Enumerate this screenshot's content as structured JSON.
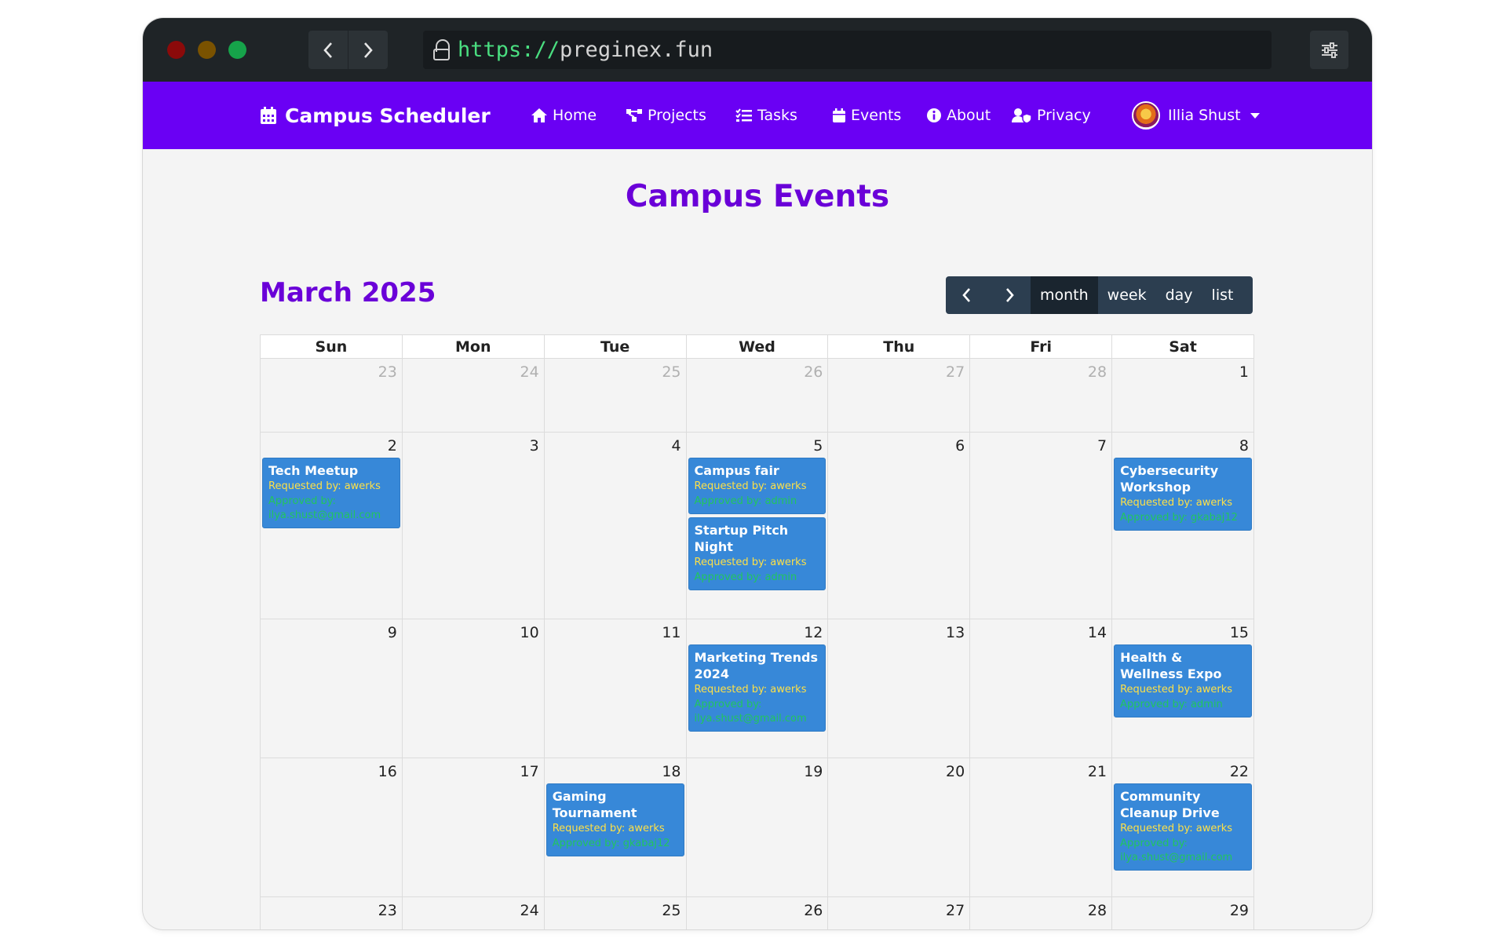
{
  "browser": {
    "url_scheme": "https://",
    "url_host": "preginex.fun"
  },
  "navbar": {
    "brand": "Campus Scheduler",
    "items": [
      {
        "label": "Home",
        "icon": "home-icon"
      },
      {
        "label": "Projects",
        "icon": "projects-icon"
      },
      {
        "label": "Tasks",
        "icon": "tasks-icon"
      },
      {
        "label": "Events",
        "icon": "calendar-icon"
      },
      {
        "label": "About",
        "icon": "info-icon"
      },
      {
        "label": "Privacy",
        "icon": "user-shield-icon"
      }
    ],
    "user": "Illia Shust"
  },
  "page": {
    "title": "Campus Events"
  },
  "calendar": {
    "month_title": "March 2025",
    "views": [
      "month",
      "week",
      "day",
      "list"
    ],
    "active_view": "month",
    "weekdays": [
      "Sun",
      "Mon",
      "Tue",
      "Wed",
      "Thu",
      "Fri",
      "Sat"
    ],
    "weeks": [
      [
        {
          "day": "23",
          "other": true
        },
        {
          "day": "24",
          "other": true
        },
        {
          "day": "25",
          "other": true
        },
        {
          "day": "26",
          "other": true
        },
        {
          "day": "27",
          "other": true
        },
        {
          "day": "28",
          "other": true
        },
        {
          "day": "1"
        }
      ],
      [
        {
          "day": "2",
          "events": [
            {
              "title": "Tech Meetup",
              "requested": "Requested by: awerks",
              "approved": "Approved by: ilya.shust@gmail.com"
            }
          ]
        },
        {
          "day": "3"
        },
        {
          "day": "4"
        },
        {
          "day": "5",
          "events": [
            {
              "title": "Campus fair",
              "requested": "Requested by: awerks",
              "approved": "Approved by: admin"
            },
            {
              "title": "Startup Pitch Night",
              "requested": "Requested by: awerks",
              "approved": "Approved by: admin"
            }
          ]
        },
        {
          "day": "6"
        },
        {
          "day": "7"
        },
        {
          "day": "8",
          "events": [
            {
              "title": "Cybersecurity Workshop",
              "requested": "Requested by: awerks",
              "approved": "Approved by: gkabaj12"
            }
          ]
        }
      ],
      [
        {
          "day": "9"
        },
        {
          "day": "10"
        },
        {
          "day": "11"
        },
        {
          "day": "12",
          "events": [
            {
              "title": "Marketing Trends 2024",
              "requested": "Requested by: awerks",
              "approved": "Approved by: ilya.shust@gmail.com"
            }
          ]
        },
        {
          "day": "13"
        },
        {
          "day": "14"
        },
        {
          "day": "15",
          "events": [
            {
              "title": "Health & Wellness Expo",
              "requested": "Requested by: awerks",
              "approved": "Approved by: admin"
            }
          ]
        }
      ],
      [
        {
          "day": "16"
        },
        {
          "day": "17"
        },
        {
          "day": "18",
          "events": [
            {
              "title": "Gaming Tournament",
              "requested": "Requested by: awerks",
              "approved": "Approved by: gkabaj12"
            }
          ]
        },
        {
          "day": "19"
        },
        {
          "day": "20"
        },
        {
          "day": "21"
        },
        {
          "day": "22",
          "events": [
            {
              "title": "Community Cleanup Drive",
              "requested": "Requested by: awerks",
              "approved": "Approved by: ilya.shust@gmail.com"
            }
          ]
        }
      ],
      [
        {
          "day": "23"
        },
        {
          "day": "24"
        },
        {
          "day": "25"
        },
        {
          "day": "26"
        },
        {
          "day": "27"
        },
        {
          "day": "28"
        },
        {
          "day": "29"
        }
      ]
    ]
  },
  "colors": {
    "accent": "#6a00f4",
    "title": "#6a00d8",
    "event_bg": "#3788d8",
    "requested_text": "#fde047",
    "approved_text": "#22c55e",
    "toolbar": "#2c3e50"
  }
}
